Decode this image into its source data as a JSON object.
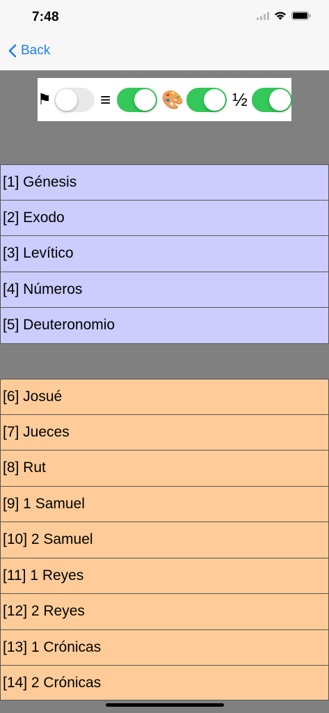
{
  "status": {
    "time": "7:48",
    "icons": [
      "signal-icon",
      "wifi-icon",
      "battery-icon"
    ]
  },
  "nav": {
    "back_label": "Back"
  },
  "toggles": [
    {
      "icon": "flag-icon",
      "glyph": "⚑",
      "on": false
    },
    {
      "icon": "menu-lines-icon",
      "glyph": "≡",
      "on": true
    },
    {
      "icon": "palette-icon",
      "glyph": "🎨",
      "on": true
    },
    {
      "icon": "half-icon",
      "glyph": "½",
      "on": true
    }
  ],
  "colors": {
    "accent": "#1a7ff5",
    "switch_on": "#34c759",
    "group1_bg": "#ccccff",
    "group2_bg": "#ffcc99",
    "separator_bg": "#808080"
  },
  "groups": [
    {
      "items": [
        "[1] Génesis",
        "[2] Exodo",
        "[3] Levítico",
        "[4] Números",
        "[5] Deuteronomio"
      ]
    },
    {
      "items": [
        "[6] Josué",
        "[7] Jueces",
        "[8] Rut",
        "[9] 1 Samuel",
        "[10] 2 Samuel",
        "[11] 1 Reyes",
        "[12] 2 Reyes",
        "[13] 1 Crónicas",
        "[14] 2 Crónicas"
      ]
    }
  ]
}
